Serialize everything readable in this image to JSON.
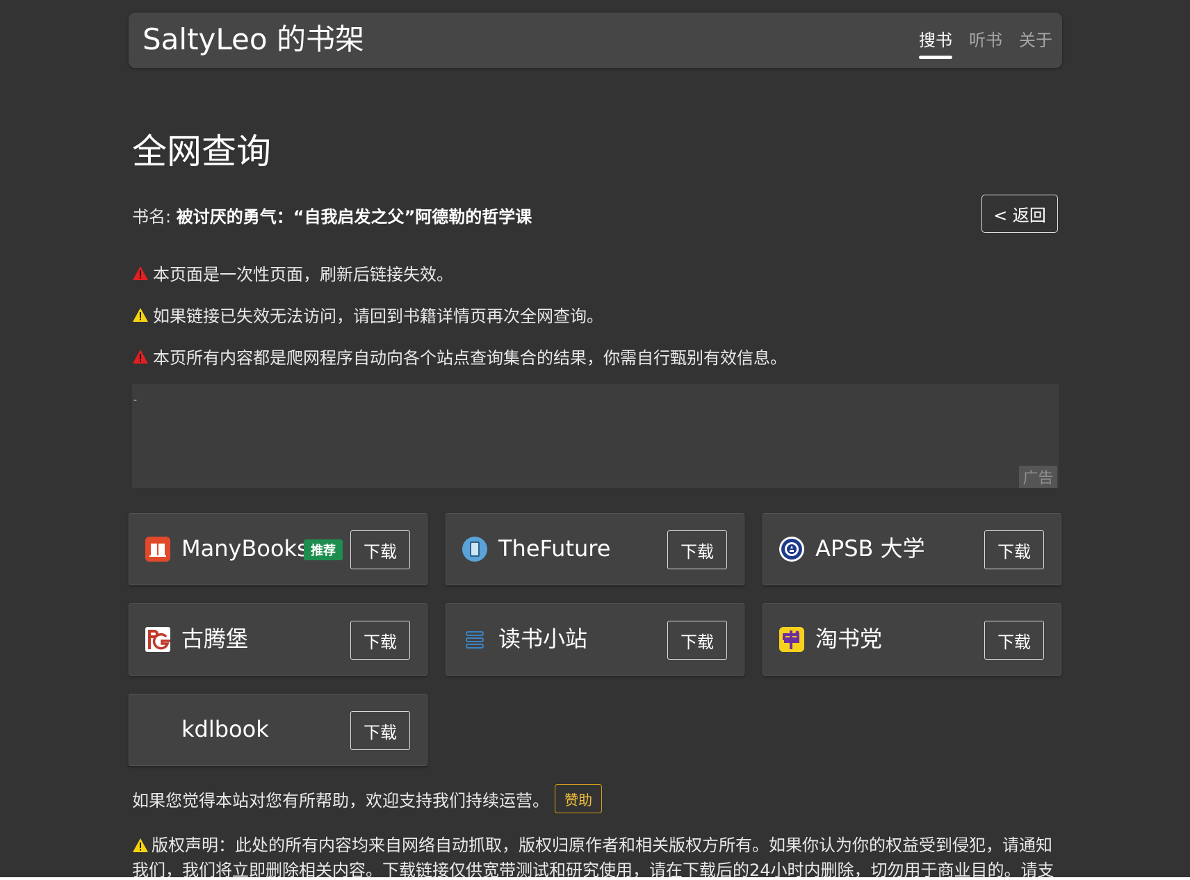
{
  "header": {
    "brand": "SaltyLeo 的书架",
    "nav": [
      {
        "label": "搜书",
        "active": true
      },
      {
        "label": "听书",
        "active": false
      },
      {
        "label": "关于",
        "active": false
      }
    ]
  },
  "main": {
    "title": "全网查询",
    "book_prefix": "书名: ",
    "book_name": "被讨厌的勇气：“自我启发之父”阿德勒的哲学课",
    "back_label": "< 返回",
    "notices": [
      {
        "icon": "warning-red-icon",
        "color": "#e02020",
        "text": "本页面是一次性页面，刷新后链接失效。"
      },
      {
        "icon": "warning-yellow-icon",
        "color": "#f5d311",
        "text": "如果链接已失效无法访问，请回到书籍详情页再次全网查询。"
      },
      {
        "icon": "warning-red-icon",
        "color": "#e02020",
        "text": "本页所有内容都是爬网程序自动向各个站点查询集合的结果，你需自行甄别有效信息。"
      }
    ],
    "ad": {
      "mark": "-",
      "label": "广告"
    }
  },
  "sources": [
    {
      "name": "ManyBooks",
      "badge": "推荐",
      "icon": "manybooks-icon",
      "download": "下载"
    },
    {
      "name": "TheFuture",
      "badge": "",
      "icon": "thefuture-icon",
      "download": "下载"
    },
    {
      "name": "APSB 大学",
      "badge": "",
      "icon": "apsb-icon",
      "download": "下载"
    },
    {
      "name": "古腾堡",
      "badge": "",
      "icon": "gutenberg-icon",
      "download": "下载"
    },
    {
      "name": "读书小站",
      "badge": "",
      "icon": "dushu-icon",
      "download": "下载"
    },
    {
      "name": "淘书党",
      "badge": "",
      "icon": "taoshudang-icon",
      "download": "下载"
    },
    {
      "name": "kdlbook",
      "badge": "",
      "icon": "",
      "download": "下载"
    }
  ],
  "footer": {
    "support_text": "如果您觉得本站对您有所帮助，欢迎支持我们持续运营。",
    "sponsor_label": "赞助",
    "copyright": "版权声明：此处的所有内容均来自网络自动抓取，版权归原作者和相关版权方所有。如果你认为你的权益受到侵犯，请通知我们，我们将立即删除相关内容。下载链接仅供宽带测试和研究使用，请在下载后的24小时内删除，切勿用于商业目的。请支"
  },
  "colors": {
    "background": "#333333",
    "header_bg": "#464646",
    "card_bg": "#424242",
    "badge_green": "#1e8e4e",
    "sponsor_gold": "#f2c23a"
  }
}
